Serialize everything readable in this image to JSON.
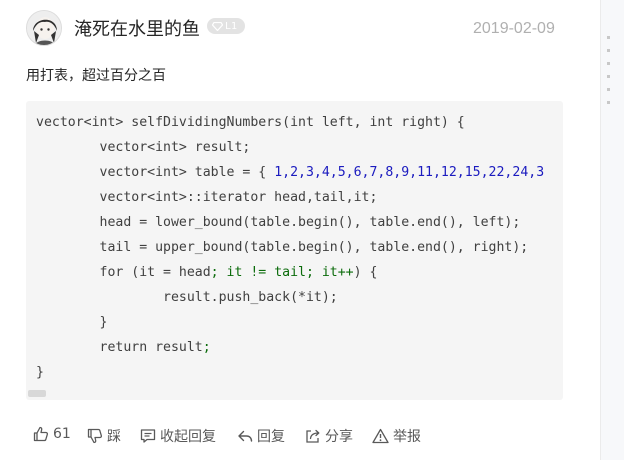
{
  "comment": {
    "author": {
      "name": "淹死在水里的鱼",
      "level": "L1"
    },
    "date": "2019-02-09",
    "text": "用打表，超过百分之百",
    "code_lines": [
      "vector<int> selfDividingNumbers(int left, int right) {",
      "        vector<int> result;",
      "        vector<int> table = { 1,2,3,4,5,6,7,8,9,11,12,15,22,24,3",
      "        vector<int>::iterator head,tail,it;",
      "        head = lower_bound(table.begin(), table.end(), left);",
      "        tail = upper_bound(table.begin(), table.end(), right);",
      "        for (it = head; it != tail; it++) {",
      "                result.push_back(*it);",
      "        }",
      "        return result;",
      "}"
    ]
  },
  "actions": {
    "like": {
      "count": "61",
      "icon": "thumbs-up-icon"
    },
    "dislike": {
      "label": "踩",
      "icon": "thumbs-down-icon"
    },
    "collapse_replies": {
      "label": "收起回复",
      "icon": "comment-icon"
    },
    "reply": {
      "label": "回复",
      "icon": "reply-icon"
    },
    "share": {
      "label": "分享",
      "icon": "share-icon"
    },
    "report": {
      "label": "举报",
      "icon": "warning-icon"
    }
  },
  "colors": {
    "code_background": "#f5f5f5",
    "number_literal": "#1b1bbf",
    "keyword": "#0b6b0b",
    "muted_text": "#b0b0b0"
  }
}
